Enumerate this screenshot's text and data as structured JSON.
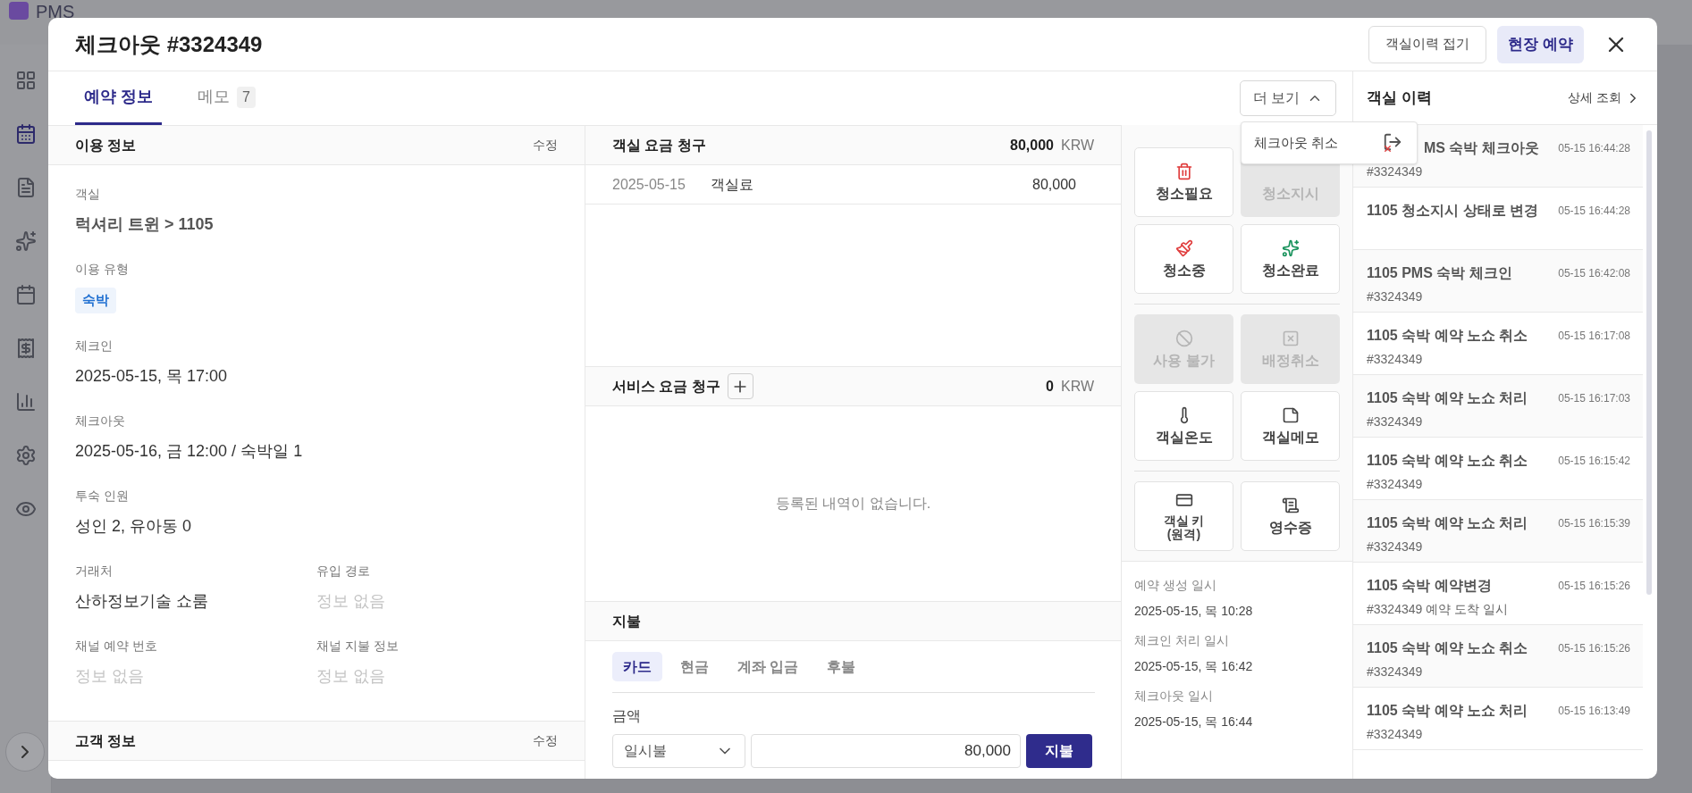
{
  "app": {
    "logo": "PMS"
  },
  "modal": {
    "title": "체크아웃 #3324349",
    "header_buttons": [
      {
        "label": "객실이력 접기",
        "kind": "outline"
      },
      {
        "label": "현장 예약",
        "kind": "primary"
      }
    ]
  },
  "tabs": [
    {
      "label": "예약 정보",
      "selected": true
    },
    {
      "label": "메모",
      "count": "7",
      "selected": false
    }
  ],
  "more_button": {
    "label": "더 보기",
    "expanded": true
  },
  "more_menu": [
    {
      "label": "체크아웃 취소"
    }
  ],
  "usage_info": {
    "title": "이용 정보",
    "edit": "수정",
    "rows": [
      [
        {
          "label": "객실",
          "value": "럭셔리 트윈 > 1105",
          "kind": "room"
        }
      ],
      [
        {
          "label": "이용 유형",
          "value": "숙박",
          "kind": "badge"
        }
      ],
      [
        {
          "label": "체크인",
          "value": "2025-05-15, 목 17:00",
          "kind": "text"
        }
      ],
      [
        {
          "label": "체크아웃",
          "value": "2025-05-16, 금 12:00 / 숙박일 1",
          "kind": "text"
        }
      ],
      [
        {
          "label": "투숙 인원",
          "value": "성인 2, 유아동 0",
          "kind": "text"
        }
      ],
      [
        {
          "label": "거래처",
          "value": "산하정보기술 쇼룸",
          "kind": "text"
        },
        {
          "label": "유입 경로",
          "value": "정보 없음",
          "kind": "empty"
        }
      ],
      [
        {
          "label": "채널 예약 번호",
          "value": "정보 없음",
          "kind": "empty"
        },
        {
          "label": "채널 지불 정보",
          "value": "정보 없음",
          "kind": "empty"
        }
      ]
    ]
  },
  "guest_info": {
    "title": "고객 정보",
    "edit": "수정"
  },
  "room_charge": {
    "title": "객실 요금 청구",
    "total": "80,000",
    "currency": "KRW",
    "items": [
      {
        "date": "2025-05-15",
        "name": "객실료",
        "amount": "80,000"
      }
    ]
  },
  "service_charge": {
    "title": "서비스 요금 청구",
    "total": "0",
    "currency": "KRW",
    "empty_text": "등록된 내역이 없습니다."
  },
  "payment": {
    "title": "지불",
    "methods": [
      {
        "label": "카드",
        "selected": true
      },
      {
        "label": "현금",
        "selected": false
      },
      {
        "label": "계좌 입금",
        "selected": false
      },
      {
        "label": "후불",
        "selected": false
      }
    ],
    "amount_label": "금액",
    "installment": "일시불",
    "amount": "80,000",
    "submit": "지불"
  },
  "actions": [
    [
      {
        "label": "청소필요",
        "disabled": false
      },
      {
        "label": "청소지시",
        "disabled": true
      },
      {
        "label": "청소중",
        "disabled": false
      },
      {
        "label": "청소완료",
        "disabled": false
      }
    ],
    [
      {
        "label": "사용 불가",
        "disabled": true
      },
      {
        "label": "배정취소",
        "disabled": true
      },
      {
        "label": "객실온도",
        "disabled": false
      },
      {
        "label": "객실메모",
        "disabled": false
      }
    ],
    [
      {
        "label": "객실 키\n(원격)",
        "disabled": false
      },
      {
        "label": "영수증",
        "disabled": false
      }
    ]
  ],
  "timestamps": [
    {
      "label": "예약 생성 일시",
      "value": "2025-05-15, 목 10:28"
    },
    {
      "label": "체크인 처리 일시",
      "value": "2025-05-15, 목 16:42"
    },
    {
      "label": "체크아웃 일시",
      "value": "2025-05-15, 목 16:44"
    }
  ],
  "history": {
    "title": "객실 이력",
    "detail": "상세 조회",
    "items": [
      {
        "title": "MS 숙박 체크아웃",
        "time": "05-15 16:44:28",
        "sub": "#3324349",
        "partly_hidden": true
      },
      {
        "title": "1105 청소지시 상태로 변경",
        "time": "05-15 16:44:28",
        "partly_hidden": false
      },
      {
        "title": "1105 PMS 숙박 체크인",
        "time": "05-15 16:42:08",
        "sub": "#3324349",
        "partly_hidden": false
      },
      {
        "title": "1105 숙박 예약 노쇼 취소",
        "time": "05-15 16:17:08",
        "sub": "#3324349",
        "partly_hidden": false
      },
      {
        "title": "1105 숙박 예약 노쇼 처리",
        "time": "05-15 16:17:03",
        "sub": "#3324349",
        "partly_hidden": false
      },
      {
        "title": "1105 숙박 예약 노쇼 취소",
        "time": "05-15 16:15:42",
        "sub": "#3324349",
        "partly_hidden": false
      },
      {
        "title": "1105 숙박 예약 노쇼 처리",
        "time": "05-15 16:15:39",
        "sub": "#3324349",
        "partly_hidden": false
      },
      {
        "title": "1105 숙박 예약변경",
        "time": "05-15 16:15:26",
        "sub": "#3324349 예약 도착 일시",
        "partly_hidden": false
      },
      {
        "title": "1105 숙박 예약 노쇼 취소",
        "time": "05-15 16:15:26",
        "sub": "#3324349",
        "partly_hidden": false
      },
      {
        "title": "1105 숙박 예약 노쇼 처리",
        "time": "05-15 16:13:49",
        "sub": "#3324349",
        "partly_hidden": false
      }
    ]
  }
}
